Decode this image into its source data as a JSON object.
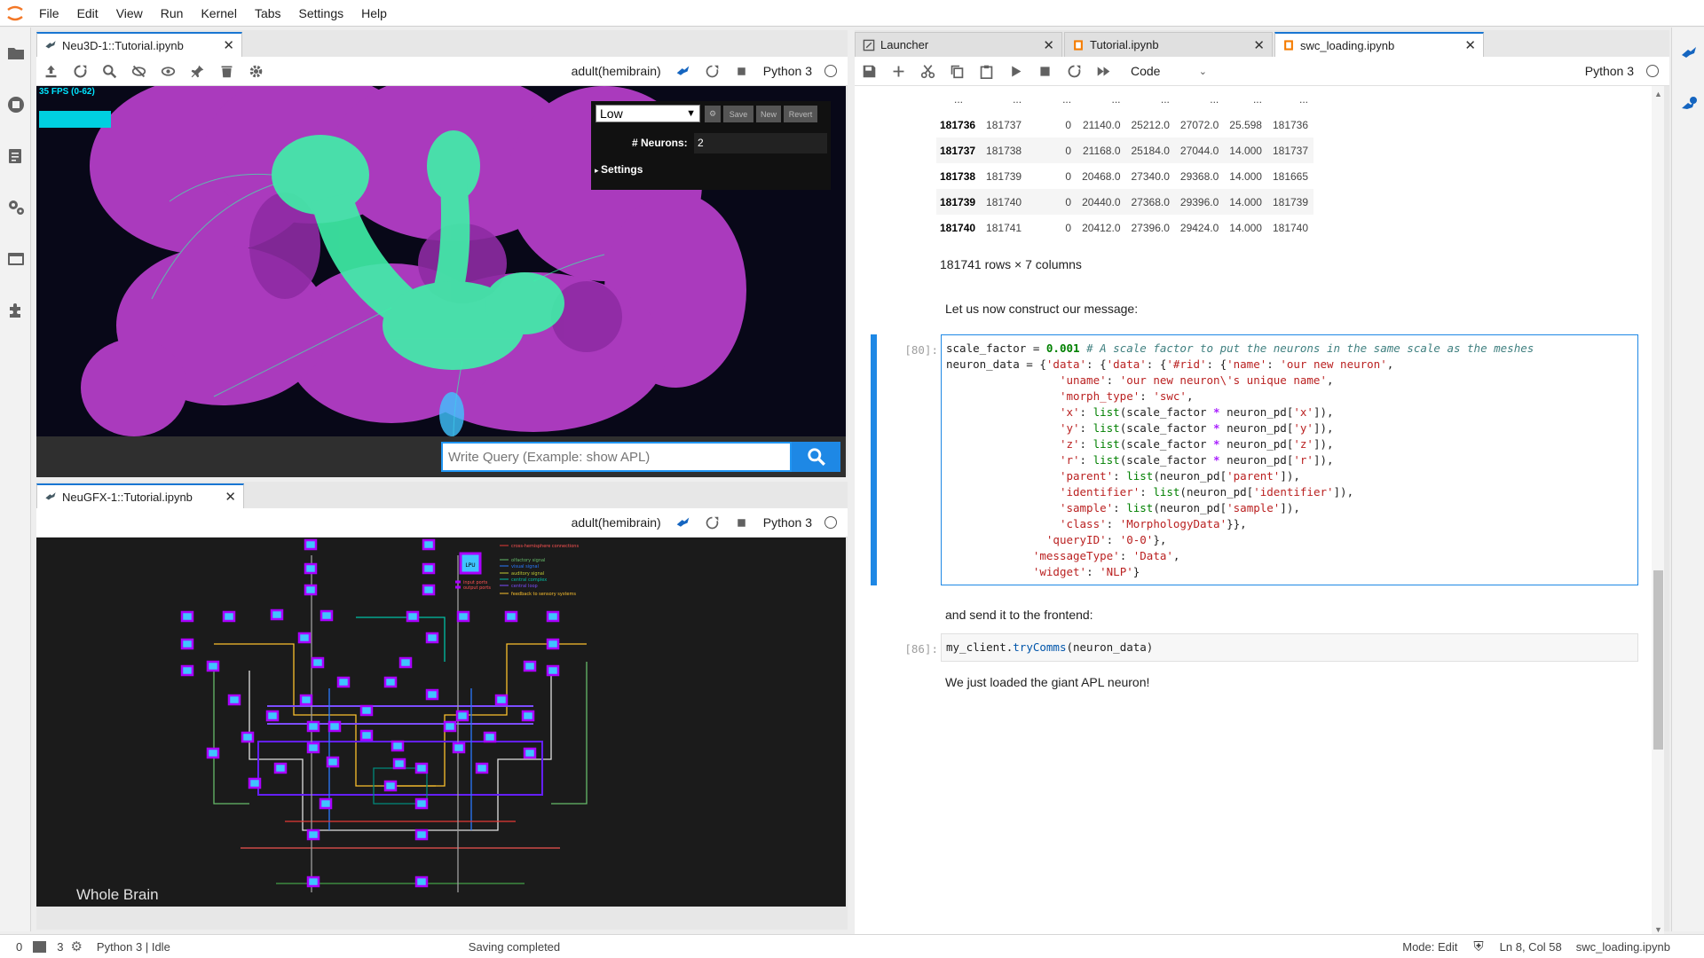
{
  "menubar": {
    "items": [
      "File",
      "Edit",
      "View",
      "Run",
      "Kernel",
      "Tabs",
      "Settings",
      "Help"
    ]
  },
  "left_sidebar": {
    "icons": [
      "folder-icon",
      "running-icon",
      "commands-icon",
      "property-inspector-icon",
      "tabs-icon",
      "extensions-icon"
    ]
  },
  "neu3d_panel": {
    "tab_title": "Neu3D-1::Tutorial.ipynb",
    "dataset": "adult(hemibrain)",
    "kernel": "Python 3",
    "fps": "35 FPS (0-62)",
    "quality_value": "Low",
    "buttons": {
      "save": "Save",
      "new": "New",
      "revert": "Revert"
    },
    "neurons_label": "# Neurons:",
    "neurons_value": "2",
    "settings_label": "Settings",
    "query_placeholder": "Write Query (Example: show APL)",
    "colors": {
      "mesh": "#b33dc6",
      "neuron": "#3ff0a8",
      "background": "#080818"
    }
  },
  "neugfx_panel": {
    "tab_title": "NeuGFX-1::Tutorial.ipynb",
    "dataset": "adult(hemibrain)",
    "kernel": "Python 3",
    "overlay_label": "Whole Brain",
    "legend": {
      "lpu_label": "LPU",
      "ports": [
        "input ports",
        "output ports"
      ],
      "entries": [
        "cross-hemisphere connections",
        "olfactory signal",
        "visual signal",
        "auditory signal",
        "central complex",
        "central loop",
        "feedback to sensory systems"
      ]
    }
  },
  "notebook": {
    "tabs": [
      {
        "label": "Launcher",
        "active": false
      },
      {
        "label": "Tutorial.ipynb",
        "active": false
      },
      {
        "label": "swc_loading.ipynb",
        "active": true
      }
    ],
    "cell_type": "Code",
    "kernel": "Python 3",
    "dataframe": {
      "ellipsis": "...",
      "rows": [
        [
          "181736",
          "181737",
          "0",
          "21140.0",
          "25212.0",
          "27072.0",
          "25.598",
          "181736"
        ],
        [
          "181737",
          "181738",
          "0",
          "21168.0",
          "25184.0",
          "27044.0",
          "14.000",
          "181737"
        ],
        [
          "181738",
          "181739",
          "0",
          "20468.0",
          "27340.0",
          "29368.0",
          "14.000",
          "181665"
        ],
        [
          "181739",
          "181740",
          "0",
          "20440.0",
          "27368.0",
          "29396.0",
          "14.000",
          "181739"
        ],
        [
          "181740",
          "181741",
          "0",
          "20412.0",
          "27396.0",
          "29424.0",
          "14.000",
          "181740"
        ]
      ],
      "shape": "181741 rows × 7 columns"
    },
    "md1": "Let us now construct our message:",
    "cell80_prompt": "[80]:",
    "md2": "and send it to the frontend:",
    "cell86_prompt": "[86]:",
    "md3": "We just loaded the giant APL neuron!"
  },
  "statusbar": {
    "terminals": "0",
    "kernels": "3",
    "kernel_status": "Python 3 | Idle",
    "save_status": "Saving completed",
    "mode": "Mode: Edit",
    "cursor": "Ln 8, Col 58",
    "file": "swc_loading.ipynb"
  }
}
